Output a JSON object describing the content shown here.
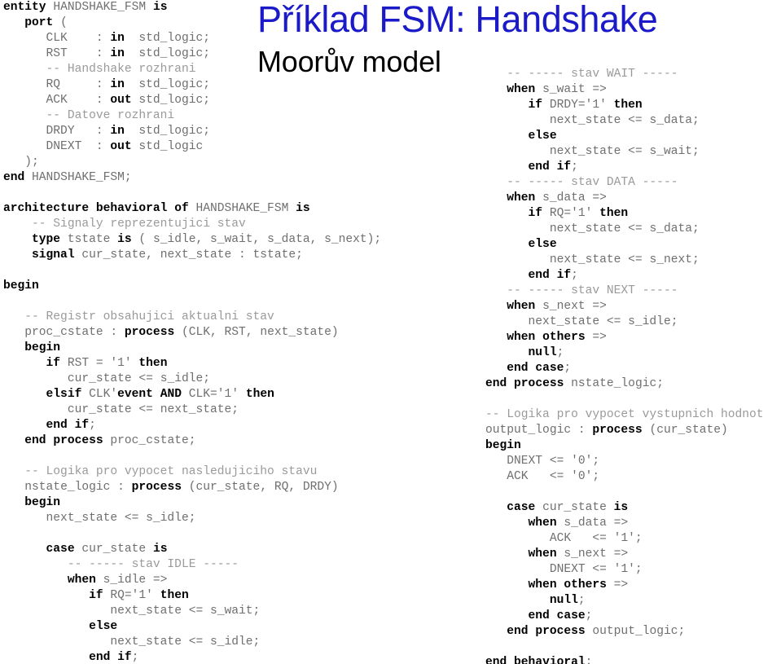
{
  "title": {
    "main": "Příklad FSM: Handshake",
    "sub": "Moorův model",
    "main_color": "#1a1ac8",
    "sub_color": "#000000"
  },
  "code_left": [
    "entity HANDSHAKE_FSM is",
    "   port (",
    "      CLK    : in  std_logic;",
    "      RST    : in  std_logic;",
    "      -- Handshake rozhrani",
    "      RQ     : in  std_logic;",
    "      ACK    : out std_logic;",
    "      -- Datove rozhrani",
    "      DRDY   : in  std_logic;",
    "      DNEXT  : out std_logic",
    "   );",
    "end HANDSHAKE_FSM;",
    "",
    "architecture behavioral of HANDSHAKE_FSM is",
    "    -- Signaly reprezentujici stav",
    "    type tstate is ( s_idle, s_wait, s_data, s_next);",
    "    signal cur_state, next_state : tstate;",
    "",
    "begin",
    "",
    "   -- Registr obsahujici aktualni stav",
    "   proc_cstate : process (CLK, RST, next_state)",
    "   begin",
    "      if RST = '1' then",
    "         cur_state <= s_idle;",
    "      elsif CLK'event AND CLK='1' then",
    "         cur_state <= next_state;",
    "      end if;",
    "   end process proc_cstate;",
    "",
    "   -- Logika pro vypocet nasledujiciho stavu",
    "   nstate_logic : process (cur_state, RQ, DRDY)",
    "   begin",
    "      next_state <= s_idle;",
    "",
    "      case cur_state is",
    "         -- ----- stav IDLE -----",
    "         when s_idle =>",
    "            if RQ='1' then",
    "               next_state <= s_wait;",
    "            else",
    "               next_state <= s_idle;",
    "            end if;"
  ],
  "code_right": [
    "   -- ----- stav WAIT -----",
    "   when s_wait =>",
    "      if DRDY='1' then",
    "         next_state <= s_data;",
    "      else",
    "         next_state <= s_wait;",
    "      end if;",
    "   -- ----- stav DATA -----",
    "   when s_data =>",
    "      if RQ='1' then",
    "         next_state <= s_data;",
    "      else",
    "         next_state <= s_next;",
    "      end if;",
    "   -- ----- stav NEXT -----",
    "   when s_next =>",
    "      next_state <= s_idle;",
    "   when others =>",
    "      null;",
    "   end case;",
    "end process nstate_logic;",
    "",
    "-- Logika pro vypocet vystupnich hodnot",
    "output_logic : process (cur_state)",
    "begin",
    "   DNEXT <= '0';",
    "   ACK   <= '0';",
    "",
    "   case cur_state is",
    "      when s_data =>",
    "         ACK   <= '1';",
    "      when s_next =>",
    "         DNEXT <= '1';",
    "      when others =>",
    "         null;",
    "      end case;",
    "   end process output_logic;",
    "",
    "end behavioral;"
  ],
  "keywords": [
    "entity",
    "port",
    "in",
    "out",
    "end",
    "architecture",
    "of",
    "is",
    "type",
    "signal",
    "begin",
    "process",
    "if",
    "then",
    "elsif",
    "event",
    "AND",
    "else",
    "case",
    "when",
    "others",
    "null",
    "behavioral"
  ]
}
